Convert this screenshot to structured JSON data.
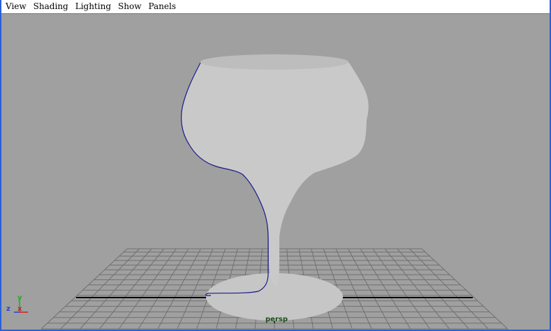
{
  "menu": {
    "view": "View",
    "shading": "Shading",
    "lighting": "Lighting",
    "show": "Show",
    "panels": "Panels"
  },
  "viewport": {
    "camera_label": "persp",
    "axis_y": "y",
    "axis_z": "z",
    "axis_x": "x",
    "background_color": "#a0a0a0",
    "grid_color": "#6e6e6e",
    "axis_line_color": "#000000",
    "curve_color": "#1a1a8a",
    "surface_color": "#c8c8c8"
  }
}
